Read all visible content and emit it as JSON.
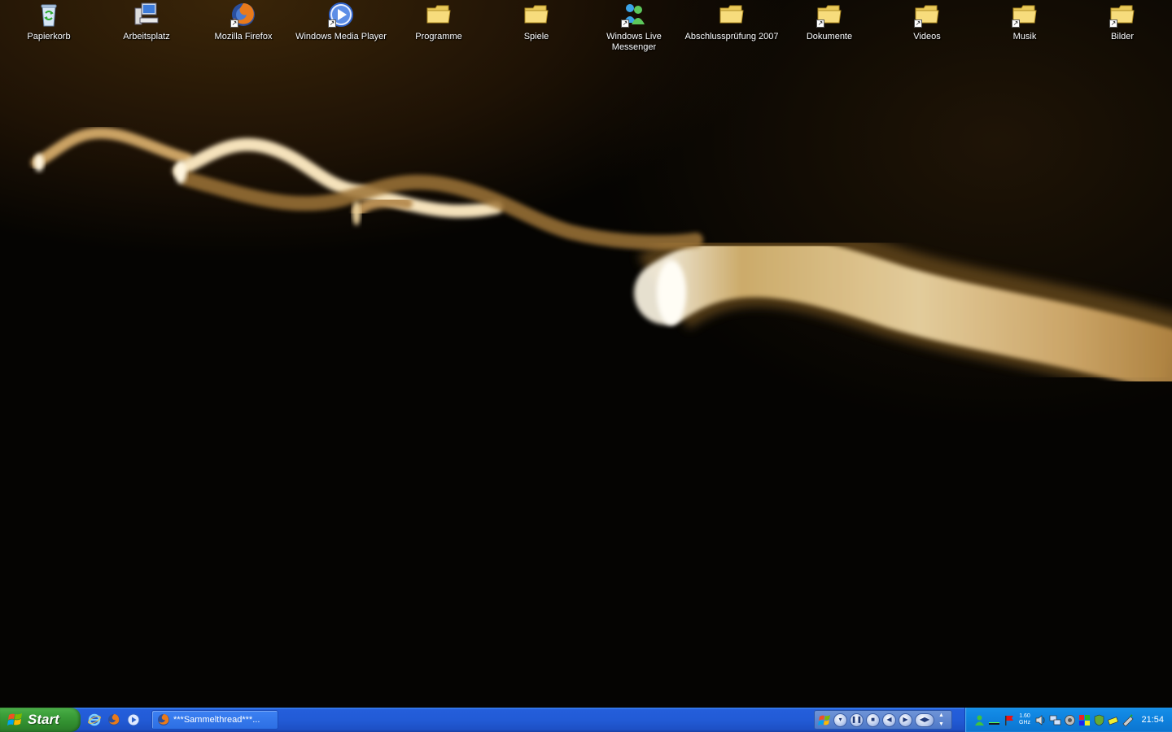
{
  "desktop_icons": [
    {
      "label": "Papierkorb",
      "icon": "recycle-bin-icon",
      "shortcut": false
    },
    {
      "label": "Arbeitsplatz",
      "icon": "my-computer-icon",
      "shortcut": false
    },
    {
      "label": "Mozilla Firefox",
      "icon": "firefox-icon",
      "shortcut": true
    },
    {
      "label": "Windows Media Player",
      "icon": "windows-media-player-icon",
      "shortcut": true
    },
    {
      "label": "Programme",
      "icon": "folder-icon",
      "shortcut": false
    },
    {
      "label": "Spiele",
      "icon": "folder-icon",
      "shortcut": false
    },
    {
      "label": "Windows Live Messenger",
      "icon": "messenger-icon",
      "shortcut": true
    },
    {
      "label": "Abschlussprüfung 2007",
      "icon": "folder-icon",
      "shortcut": false
    },
    {
      "label": "Dokumente",
      "icon": "folder-icon",
      "shortcut": true
    },
    {
      "label": "Videos",
      "icon": "folder-icon",
      "shortcut": true
    },
    {
      "label": "Musik",
      "icon": "folder-icon",
      "shortcut": true
    },
    {
      "label": "Bilder",
      "icon": "folder-icon",
      "shortcut": true
    }
  ],
  "taskbar": {
    "start_label": "Start",
    "quick_launch": [
      "internet-explorer-icon",
      "firefox-icon",
      "windows-media-player-icon"
    ],
    "task_label": "***Sammelthread***...",
    "clock": "21:54",
    "cpu_speed_line1": "1.60",
    "cpu_speed_line2": "GHz"
  },
  "colors": {
    "taskbar_blue": "#225bd6",
    "start_green": "#3c9f3a",
    "tray_blue": "#0f84e0",
    "light_trail": "#e8c98a"
  }
}
